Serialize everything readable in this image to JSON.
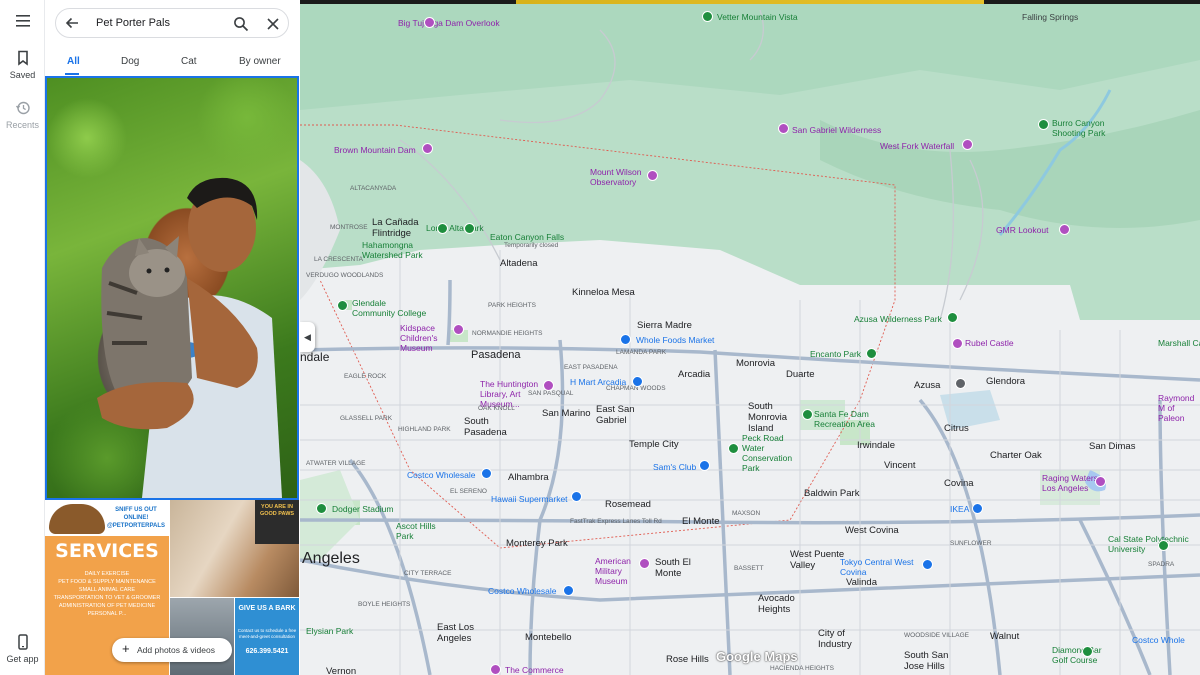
{
  "rail": {
    "menu_icon": "hamburger-icon",
    "saved": "Saved",
    "recents": "Recents",
    "get_app": "Get app"
  },
  "search": {
    "query": "Pet Porter Pals"
  },
  "tabs": [
    "All",
    "Dog",
    "Cat",
    "By owner"
  ],
  "photos": {
    "flyer": {
      "header": "SNIFF US OUT ONLINE!",
      "handle": "@PETPORTERPALS",
      "title": "SERVICES",
      "lines": [
        "DAILY EXERCISE",
        "PET FOOD & SUPPLY MAINTENANCE",
        "SMALL ANIMAL CARE",
        "TRANSPORTATION TO VET & GROOMER",
        "ADMINISTRATION OF PET MEDICINE",
        "PERSONAL P..."
      ]
    },
    "good_paws": "YOU ARE IN GOOD PAWS",
    "bark": {
      "title": "GIVE US A BARK",
      "body": "Contact us to schedule a free meet-and-greet consultation",
      "phone": "626.399.5421"
    },
    "add_button": "Add photos & videos"
  },
  "map": {
    "watermark": "Google Maps",
    "labels": [
      {
        "t": "Big Tujunga Dam Overlook",
        "k": "poi"
      },
      {
        "t": "Vetter Mountain Vista",
        "k": "park"
      },
      {
        "t": "Falling Springs",
        "k": ""
      },
      {
        "t": "San Gabriel Wilderness",
        "k": "poi"
      },
      {
        "t": "Burro Canyon Shooting Park",
        "k": "park"
      },
      {
        "t": "Brown Mountain Dam",
        "k": "poi"
      },
      {
        "t": "West Fork Waterfall",
        "k": "poi"
      },
      {
        "t": "Mount Wilson Observatory",
        "k": "poi"
      },
      {
        "t": "ALTACANYADA",
        "k": "small"
      },
      {
        "t": "La Cañada Flintridge",
        "k": "city"
      },
      {
        "t": "Hahamongna Watershed Park",
        "k": "park"
      },
      {
        "t": "Loma Alta Park",
        "k": "park"
      },
      {
        "t": "Eaton Canyon Falls",
        "k": "park"
      },
      {
        "t": "Temporarily closed",
        "k": "small"
      },
      {
        "t": "GMR Lookout",
        "k": "poi"
      },
      {
        "t": "Altadena",
        "k": "city"
      },
      {
        "t": "Glendale Community College",
        "k": "park"
      },
      {
        "t": "Kinneloa Mesa",
        "k": "city"
      },
      {
        "t": "Azusa Wilderness Park",
        "k": "park"
      },
      {
        "t": "Sierra Madre",
        "k": "city"
      },
      {
        "t": "Whole Foods Market",
        "k": "shop"
      },
      {
        "t": "Kidspace Children's Museum",
        "k": "poi"
      },
      {
        "t": "Rubel Castle",
        "k": "poi"
      },
      {
        "t": "Marshall Canyon",
        "k": "park"
      },
      {
        "t": "Pasadena",
        "k": "big"
      },
      {
        "t": "Encanto Park",
        "k": "park"
      },
      {
        "t": "Monrovia",
        "k": "city"
      },
      {
        "t": "Arcadia",
        "k": "city"
      },
      {
        "t": "Duarte",
        "k": "city"
      },
      {
        "t": "Azusa",
        "k": "city"
      },
      {
        "t": "Glendora",
        "k": "city"
      },
      {
        "t": "The Huntington Library, Art Museum...",
        "k": "poi"
      },
      {
        "t": "H Mart Arcadia",
        "k": "shop"
      },
      {
        "t": "South Monrovia Island",
        "k": "city"
      },
      {
        "t": "Santa Fe Dam Recreation Area",
        "k": "park"
      },
      {
        "t": "Raymond M of Paleon",
        "k": "poi"
      },
      {
        "t": "San Marino",
        "k": "city"
      },
      {
        "t": "East San Gabriel",
        "k": "city"
      },
      {
        "t": "South Pasadena",
        "k": "city"
      },
      {
        "t": "Citrus",
        "k": "city"
      },
      {
        "t": "Temple City",
        "k": "city"
      },
      {
        "t": "Peck Road Water Conservation Park",
        "k": "park"
      },
      {
        "t": "Irwindale",
        "k": "city"
      },
      {
        "t": "San Dimas",
        "k": "city"
      },
      {
        "t": "Charter Oak",
        "k": "city"
      },
      {
        "t": "Costco Wholesale",
        "k": "shop"
      },
      {
        "t": "Sam's Club",
        "k": "shop"
      },
      {
        "t": "Vincent",
        "k": "city"
      },
      {
        "t": "Alhambra",
        "k": "city"
      },
      {
        "t": "Raging Waters Los Angeles",
        "k": "poi"
      },
      {
        "t": "Covina",
        "k": "city"
      },
      {
        "t": "Baldwin Park",
        "k": "city"
      },
      {
        "t": "Hawaii Supermarket",
        "k": "shop"
      },
      {
        "t": "Rosemead",
        "k": "city"
      },
      {
        "t": "IKEA",
        "k": "shop"
      },
      {
        "t": "Dodger Stadium",
        "k": "park"
      },
      {
        "t": "El Monte",
        "k": "city"
      },
      {
        "t": "West Covina",
        "k": "city"
      },
      {
        "t": "Ascot Hills Park",
        "k": "park"
      },
      {
        "t": "Monterey Park",
        "k": "city"
      },
      {
        "t": "Cal State Polytechnic University",
        "k": "park"
      },
      {
        "t": "Angeles",
        "k": "big"
      },
      {
        "t": "West Puente Valley",
        "k": "city"
      },
      {
        "t": "South El Monte",
        "k": "city"
      },
      {
        "t": "American Military Museum",
        "k": "poi"
      },
      {
        "t": "Tokyo Central West Covina",
        "k": "shop"
      },
      {
        "t": "Valinda",
        "k": "city"
      },
      {
        "t": "Costco Wholesale",
        "k": "shop"
      },
      {
        "t": "Avocado Heights",
        "k": "city"
      },
      {
        "t": "East Los Angeles",
        "k": "city"
      },
      {
        "t": "Montebello",
        "k": "city"
      },
      {
        "t": "City of Industry",
        "k": "city"
      },
      {
        "t": "Walnut",
        "k": "city"
      },
      {
        "t": "Costco Whole",
        "k": "shop"
      },
      {
        "t": "Rose Hills",
        "k": "city"
      },
      {
        "t": "South San Jose Hills",
        "k": "city"
      },
      {
        "t": "Diamond Bar Golf Course",
        "k": "park"
      },
      {
        "t": "Vernon",
        "k": "city"
      },
      {
        "t": "The Commerce",
        "k": "poi"
      },
      {
        "t": "ndale",
        "k": "big"
      },
      {
        "t": "Elysian Park",
        "k": "park"
      },
      {
        "t": "MONTROSE",
        "k": "small"
      },
      {
        "t": "LA CRESCENTA",
        "k": "small"
      },
      {
        "t": "EAGLE ROCK",
        "k": "small"
      },
      {
        "t": "HIGHLAND PARK",
        "k": "small"
      },
      {
        "t": "EL SERENO",
        "k": "small"
      },
      {
        "t": "CITY TERRACE",
        "k": "small"
      },
      {
        "t": "BOYLE HEIGHTS",
        "k": "small"
      },
      {
        "t": "GLASSELL PARK",
        "k": "small"
      },
      {
        "t": "ATWATER VILLAGE",
        "k": "small"
      },
      {
        "t": "VERDUGO WOODLANDS",
        "k": "small"
      },
      {
        "t": "PARK HEIGHTS",
        "k": "small"
      },
      {
        "t": "NORMANDIE HEIGHTS",
        "k": "small"
      },
      {
        "t": "EAST PASADENA",
        "k": "small"
      },
      {
        "t": "CHAPMAN WOODS",
        "k": "small"
      },
      {
        "t": "LAMANDA PARK",
        "k": "small"
      },
      {
        "t": "SAN PASQUAL",
        "k": "small"
      },
      {
        "t": "OAK KNOLL",
        "k": "small"
      },
      {
        "t": "MAXSON",
        "k": "small"
      },
      {
        "t": "SPADRA",
        "k": "small"
      },
      {
        "t": "SUNFLOWER",
        "k": "small"
      },
      {
        "t": "BASSETT",
        "k": "small"
      },
      {
        "t": "WOODSIDE VILLAGE",
        "k": "small"
      },
      {
        "t": "HACIENDA HEIGHTS",
        "k": "small"
      },
      {
        "t": "FastTrak Express Lanes Toll Rd",
        "k": "small"
      }
    ],
    "shields": [
      "2",
      "2",
      "2",
      "39",
      "39",
      "210",
      "210",
      "210",
      "210",
      "134",
      "2",
      "110",
      "110",
      "5",
      "5",
      "10",
      "10",
      "10",
      "10",
      "710",
      "605",
      "605",
      "605",
      "57",
      "57",
      "164",
      "66",
      "60",
      "60",
      "19",
      "72"
    ]
  },
  "colors": {
    "accent": "#1a73e8",
    "mountain": "#b7dcc6",
    "urban": "#f1f3f4",
    "highway": "#a9b6c8"
  }
}
